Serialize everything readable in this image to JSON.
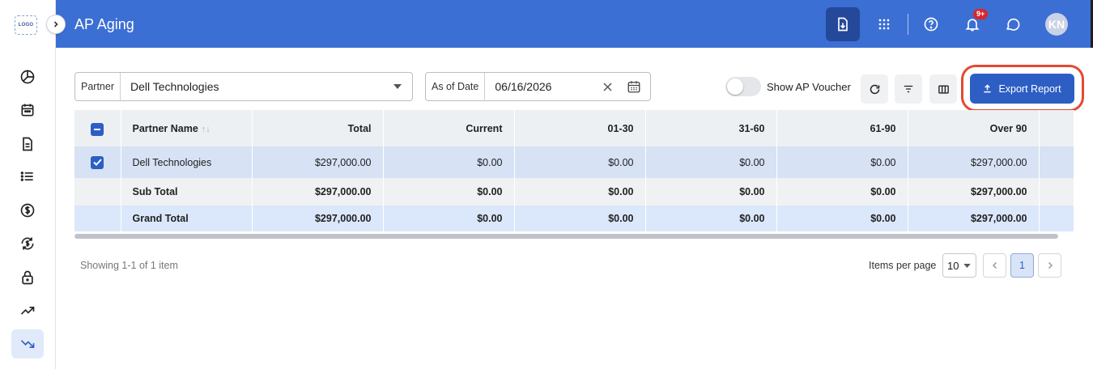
{
  "app": {
    "logo_text": "LOGO"
  },
  "sidebar": {
    "items": [
      {
        "name": "dashboard-icon"
      },
      {
        "name": "calendar-icon"
      },
      {
        "name": "document-icon"
      },
      {
        "name": "list-icon"
      },
      {
        "name": "dollar-icon"
      },
      {
        "name": "dollar-sync-icon"
      },
      {
        "name": "lock-icon"
      },
      {
        "name": "trending-up-icon"
      },
      {
        "name": "trending-down-icon",
        "active": true
      }
    ]
  },
  "header": {
    "title": "AP Aging",
    "notification_badge": "9+",
    "avatar_initials": "KN"
  },
  "filters": {
    "partner_label": "Partner",
    "partner_value": "Dell Technologies",
    "date_label": "As of Date",
    "date_value": "06/16/2026",
    "toggle_label": "Show AP Voucher",
    "toggle_on": false,
    "export_label": "Export Report"
  },
  "table": {
    "columns": [
      "Partner Name",
      "Total",
      "Current",
      "01-30",
      "31-60",
      "61-90",
      "Over 90"
    ],
    "rows": [
      {
        "partner": "Dell Technologies",
        "total": "$297,000.00",
        "current": "$0.00",
        "d01_30": "$0.00",
        "d31_60": "$0.00",
        "d61_90": "$0.00",
        "over90": "$297,000.00",
        "checked": true
      }
    ],
    "subtotal": {
      "label": "Sub Total",
      "total": "$297,000.00",
      "current": "$0.00",
      "d01_30": "$0.00",
      "d31_60": "$0.00",
      "d61_90": "$0.00",
      "over90": "$297,000.00"
    },
    "grandtotal": {
      "label": "Grand Total",
      "total": "$297,000.00",
      "current": "$0.00",
      "d01_30": "$0.00",
      "d31_60": "$0.00",
      "d61_90": "$0.00",
      "over90": "$297,000.00"
    }
  },
  "pagination": {
    "showing": "Showing 1-1 of 1 item",
    "items_per_page_label": "Items per page",
    "items_per_page": "10",
    "current_page": "1"
  },
  "colors": {
    "header_bg": "#3b6fd4",
    "primary": "#2d5ec4",
    "highlight_ring": "#e14a32",
    "badge": "#d9262a"
  }
}
